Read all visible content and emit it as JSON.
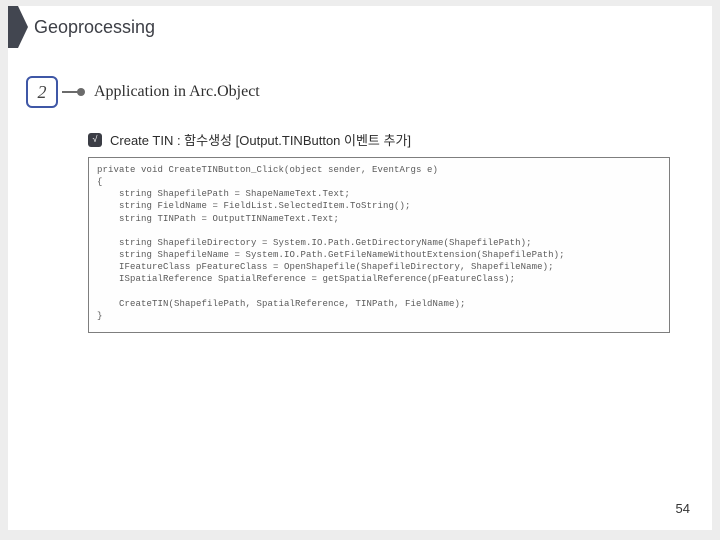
{
  "title": "Geoprocessing",
  "section": {
    "number": "2",
    "heading": "Application in Arc.Object"
  },
  "bullet": {
    "check": "√",
    "label": "Create TIN : 함수생성  [Output.TINButton 이벤트 추가]"
  },
  "code": "private void CreateTINButton_Click(object sender, EventArgs e)\n{\n    string ShapefilePath = ShapeNameText.Text;\n    string FieldName = FieldList.SelectedItem.ToString();\n    string TINPath = OutputTINNameText.Text;\n\n    string ShapefileDirectory = System.IO.Path.GetDirectoryName(ShapefilePath);\n    string ShapefileName = System.IO.Path.GetFileNameWithoutExtension(ShapefilePath);\n    IFeatureClass pFeatureClass = OpenShapefile(ShapefileDirectory, ShapefileName);\n    ISpatialReference SpatialReference = getSpatialReference(pFeatureClass);\n\n    CreateTIN(ShapefilePath, SpatialReference, TINPath, FieldName);\n}",
  "pageNumber": "54"
}
